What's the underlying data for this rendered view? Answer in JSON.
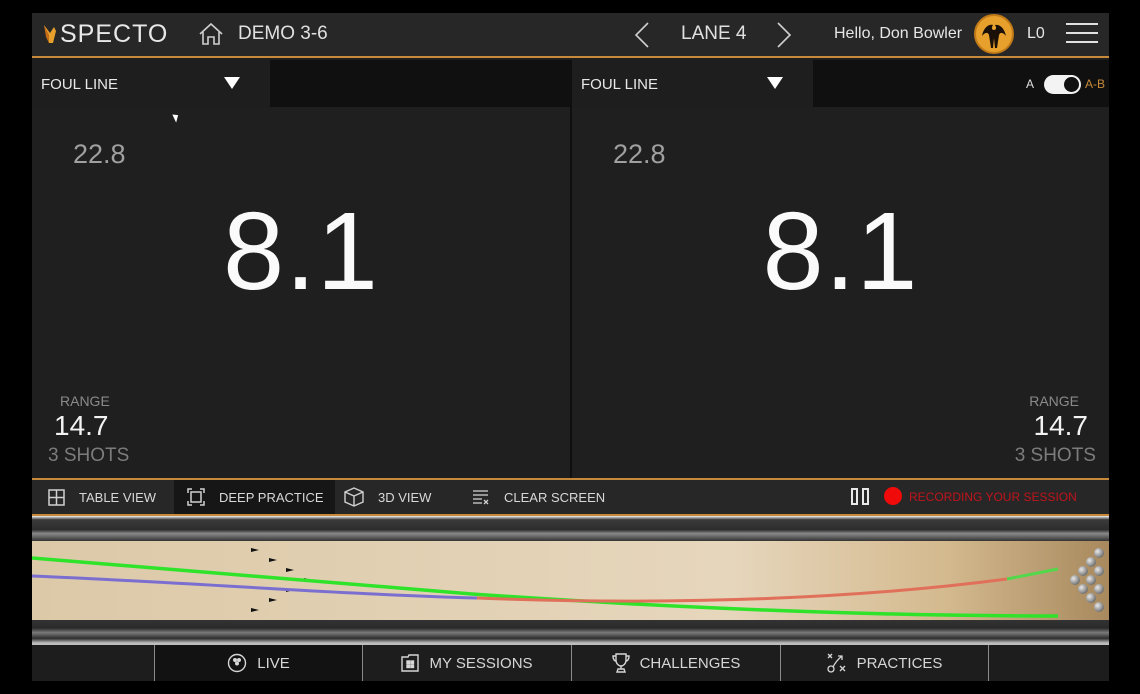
{
  "header": {
    "logo_text": "SPECTO",
    "session_title": "DEMO 3-6",
    "lane_name": "LANE 4",
    "greeting": "Hello, Don Bowler",
    "level": "L0",
    "icons": {
      "home": "home-icon",
      "prev": "chevron-left-icon",
      "next": "chevron-right-icon",
      "avatar": "user-avatar",
      "menu": "hamburger-menu-icon"
    }
  },
  "panels": [
    {
      "id": "A",
      "dropdown_value": "FOUL LINE",
      "average": "22.8",
      "value": "8.1",
      "range_label": "RANGE",
      "range_value": "14.7",
      "shots": "3 SHOTS"
    },
    {
      "id": "B",
      "dropdown_value": "FOUL LINE",
      "average": "22.8",
      "value": "8.1",
      "range_label": "RANGE",
      "range_value": "14.7",
      "shots": "3 SHOTS"
    }
  ],
  "compare_toggle": {
    "left_label": "A",
    "right_label": "A-B",
    "state": "A-B"
  },
  "toolbar": {
    "items": [
      {
        "label": "TABLE VIEW",
        "icon": "grid-icon",
        "active": false
      },
      {
        "label": "DEEP PRACTICE",
        "icon": "frame-icon",
        "active": true
      },
      {
        "label": "3D  VIEW",
        "icon": "cube-icon",
        "active": false
      },
      {
        "label": "CLEAR SCREEN",
        "icon": "clear-list-icon",
        "active": false
      }
    ],
    "recording_text": "RECORDING YOUR SESSION"
  },
  "lane_view": {
    "shots": [
      {
        "color": "#2fe02a",
        "segments": [
          "green"
        ]
      },
      {
        "color": "#7b6ecb",
        "segments": [
          "purple",
          "red",
          "green"
        ]
      },
      {
        "color": "#2fe02a",
        "segments": [
          "green"
        ]
      }
    ],
    "colors": {
      "green": "#2ee32a",
      "purple": "#7a6fd0",
      "red": "#e0705a",
      "accent": "#c68a3a",
      "recording": "#f00a0a"
    }
  },
  "bottom_nav": {
    "items": [
      {
        "label": "LIVE",
        "icon": "bowling-ball-icon",
        "active": true
      },
      {
        "label": "MY SESSIONS",
        "icon": "folder-icon",
        "active": false
      },
      {
        "label": "CHALLENGES",
        "icon": "trophy-icon",
        "active": false
      },
      {
        "label": "PRACTICES",
        "icon": "strategy-icon",
        "active": false
      }
    ]
  }
}
